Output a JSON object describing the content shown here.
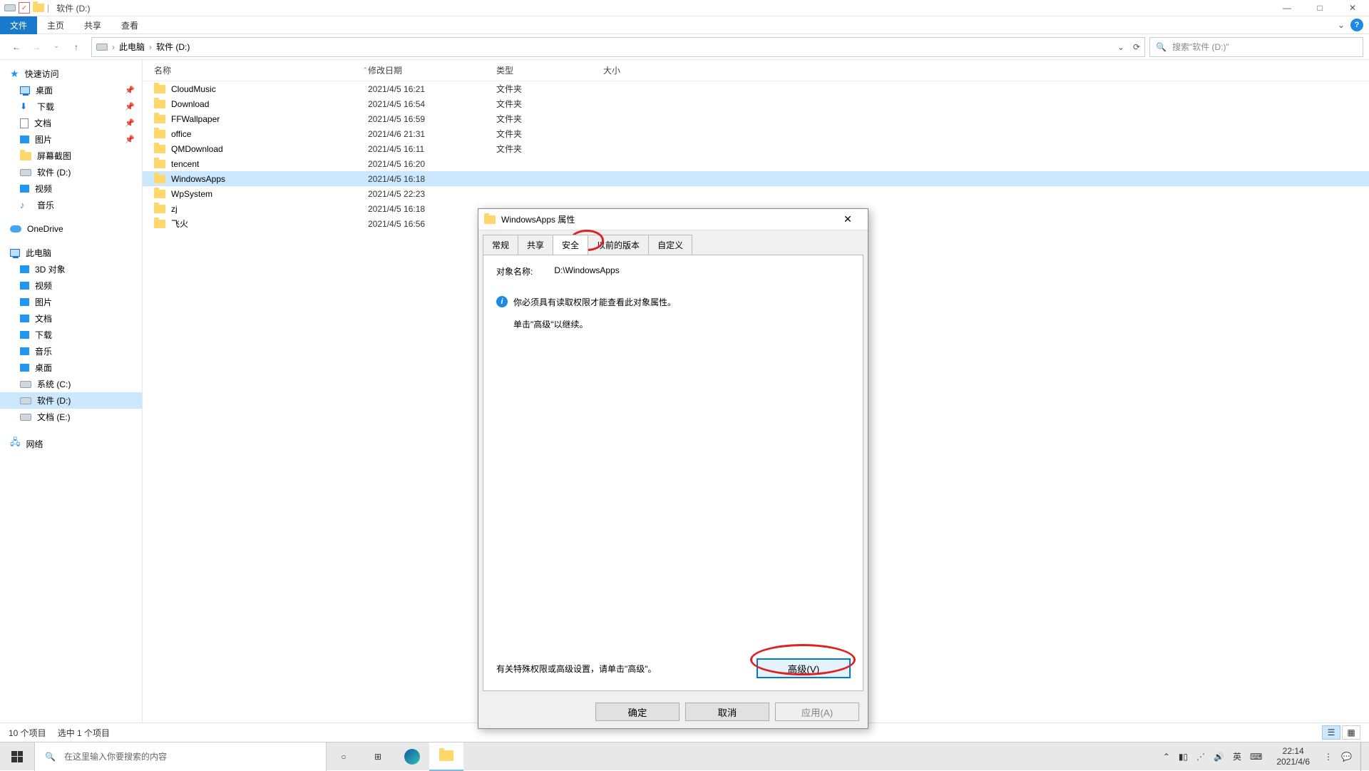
{
  "titlebar": {
    "title": "软件 (D:)"
  },
  "win_controls": {
    "min": "—",
    "max": "□",
    "close": "✕"
  },
  "ribbon": {
    "file": "文件",
    "tabs": [
      "主页",
      "共享",
      "查看"
    ]
  },
  "nav": {
    "crumbs": [
      "此电脑",
      "软件 (D:)"
    ],
    "search_placeholder": "搜索\"软件 (D:)\""
  },
  "columns": {
    "name": "名称",
    "date": "修改日期",
    "type": "类型",
    "size": "大小"
  },
  "rows": [
    {
      "name": "CloudMusic",
      "date": "2021/4/5 16:21",
      "type": "文件夹"
    },
    {
      "name": "Download",
      "date": "2021/4/5 16:54",
      "type": "文件夹"
    },
    {
      "name": "FFWallpaper",
      "date": "2021/4/5 16:59",
      "type": "文件夹"
    },
    {
      "name": "office",
      "date": "2021/4/6 21:31",
      "type": "文件夹"
    },
    {
      "name": "QMDownload",
      "date": "2021/4/5 16:11",
      "type": "文件夹"
    },
    {
      "name": "tencent",
      "date": "2021/4/5 16:20",
      "type": ""
    },
    {
      "name": "WindowsApps",
      "date": "2021/4/5 16:18",
      "type": "",
      "selected": true
    },
    {
      "name": "WpSystem",
      "date": "2021/4/5 22:23",
      "type": ""
    },
    {
      "name": "zj",
      "date": "2021/4/5 16:18",
      "type": ""
    },
    {
      "name": "飞火",
      "date": "2021/4/5 16:56",
      "type": ""
    }
  ],
  "sidebar": {
    "quick": {
      "label": "快速访问",
      "items": [
        {
          "label": "桌面",
          "pinned": true,
          "icon": "desktop"
        },
        {
          "label": "下载",
          "pinned": true,
          "icon": "download"
        },
        {
          "label": "文档",
          "pinned": true,
          "icon": "doc"
        },
        {
          "label": "图片",
          "pinned": true,
          "icon": "pic"
        },
        {
          "label": "屏幕截图",
          "icon": "folder"
        },
        {
          "label": "软件 (D:)",
          "icon": "disk"
        },
        {
          "label": "视频",
          "icon": "video"
        },
        {
          "label": "音乐",
          "icon": "music"
        }
      ]
    },
    "onedrive": "OneDrive",
    "thispc": {
      "label": "此电脑",
      "items": [
        {
          "label": "3D 对象"
        },
        {
          "label": "视频"
        },
        {
          "label": "图片"
        },
        {
          "label": "文档"
        },
        {
          "label": "下载"
        },
        {
          "label": "音乐"
        },
        {
          "label": "桌面"
        },
        {
          "label": "系统 (C:)"
        },
        {
          "label": "软件 (D:)",
          "selected": true
        },
        {
          "label": "文档 (E:)"
        }
      ]
    },
    "network": "网络"
  },
  "status": {
    "count": "10 个项目",
    "selected": "选中 1 个项目"
  },
  "taskbar": {
    "search_placeholder": "在这里输入你要搜索的内容",
    "ime": "英",
    "time": "22:14",
    "date": "2021/4/6"
  },
  "dialog": {
    "title": "WindowsApps 属性",
    "tabs": [
      "常规",
      "共享",
      "安全",
      "以前的版本",
      "自定义"
    ],
    "active_tab": 2,
    "object_label": "对象名称:",
    "object_value": "D:\\WindowsApps",
    "msg1": "你必须具有读取权限才能查看此对象属性。",
    "msg2": "单击\"高级\"以继续。",
    "adv_text": "有关特殊权限或高级设置，请单击\"高级\"。",
    "adv_btn": "高级(V)",
    "ok": "确定",
    "cancel": "取消",
    "apply": "应用(A)"
  }
}
